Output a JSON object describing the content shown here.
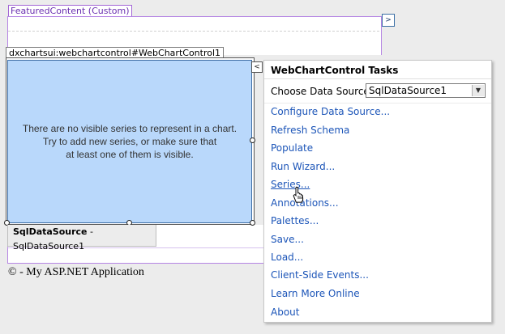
{
  "featured_content": {
    "tag_label": "FeaturedContent (Custom)",
    "expand_glyph": "&gt;"
  },
  "chart_control": {
    "tag_label": "dxchartsui:webchartcontrol#WebChartControl1",
    "empty_message_lines": [
      "There are no visible series to represent in a chart.",
      "Try to add new series, or make sure that",
      "at least one of them is visible."
    ],
    "smart_tag_glyph": "&lt;"
  },
  "sql_data_source": {
    "type": "SqlDataSource",
    "separator": " - ",
    "name": "SqlDataSource1"
  },
  "footer": {
    "text": "© - My ASP.NET Application"
  },
  "tasks_panel": {
    "title": "WebChartControl Tasks",
    "data_source_label": "Choose Data Source:",
    "data_source_value": "SqlDataSource1",
    "links": [
      "Configure Data Source...",
      "Refresh Schema",
      "Populate",
      "Run Wizard...",
      "Series...",
      "Annotations...",
      "Palettes...",
      "Save...",
      "Load...",
      "Client-Side Events...",
      "Learn More Online",
      "About"
    ]
  },
  "icons": {
    "pointer": "hand-pointer-icon"
  },
  "colors": {
    "container_accent": "#a366d6",
    "link": "#1c55b8",
    "chart_fill": "#b9d8fb"
  }
}
